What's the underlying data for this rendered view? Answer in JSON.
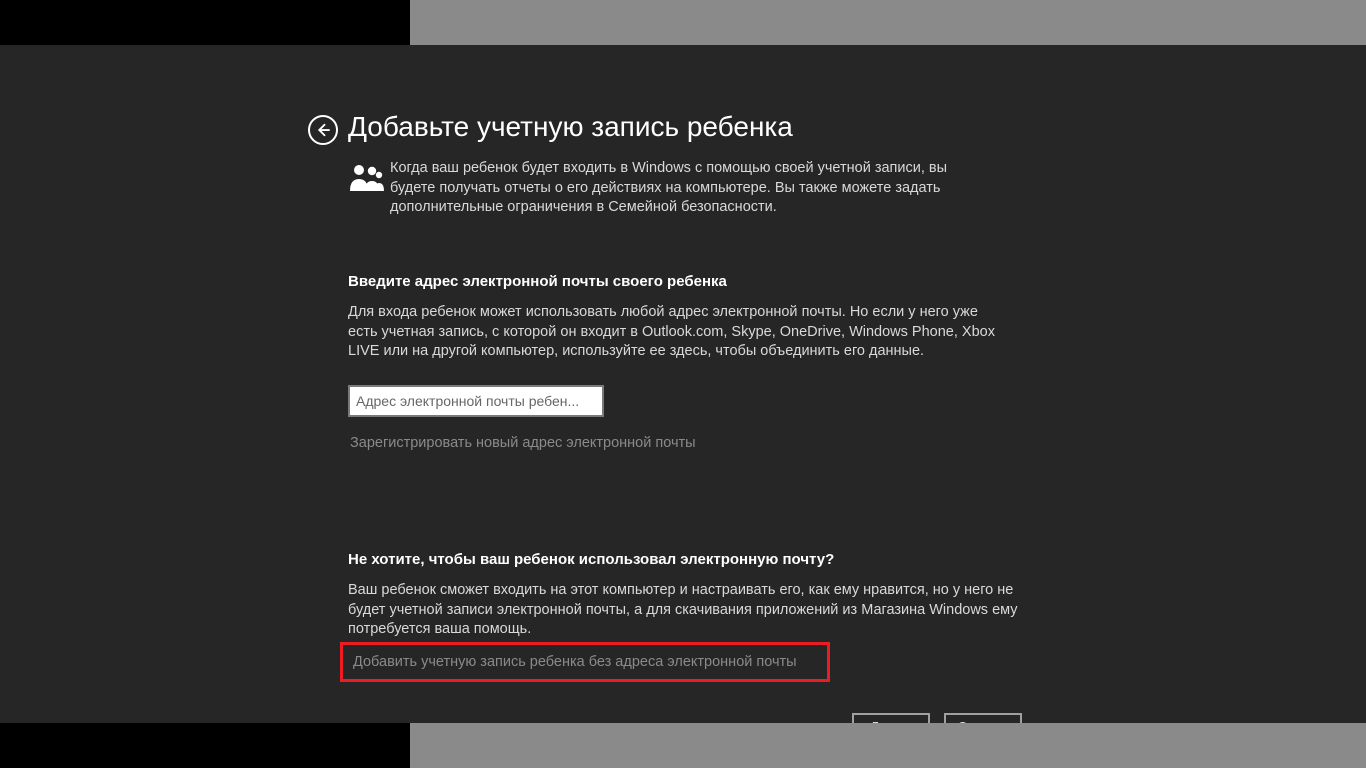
{
  "header": {
    "title": "Добавьте учетную запись ребенка"
  },
  "intro": "Когда ваш ребенок будет входить в Windows с помощью своей учетной записи, вы будете получать отчеты о его действиях на компьютере. Вы также можете задать дополнительные ограничения в Семейной безопасности.",
  "section_email": {
    "heading": "Введите адрес электронной почты своего ребенка",
    "text": "Для входа ребенок может использовать любой адрес электронной почты. Но если у него уже есть учетная запись, с которой он входит в Outlook.com, Skype, OneDrive, Windows Phone, Xbox LIVE или на другой компьютер, используйте ее здесь, чтобы объединить его данные.",
    "placeholder": "Адрес электронной почты ребен...",
    "register_link": "Зарегистрировать новый адрес электронной почты"
  },
  "section_noemail": {
    "heading": "Не хотите, чтобы ваш ребенок использовал электронную почту?",
    "text": "Ваш ребенок сможет входить на этот компьютер и настраивать его, как ему нравится, но у него не будет учетной записи электронной почты, а для скачивания приложений из Магазина Windows ему потребуется ваша помощь.",
    "add_without_email": "Добавить учетную запись ребенка без адреса электронной почты"
  },
  "buttons": {
    "next": "Далее",
    "cancel": "Отмена"
  }
}
